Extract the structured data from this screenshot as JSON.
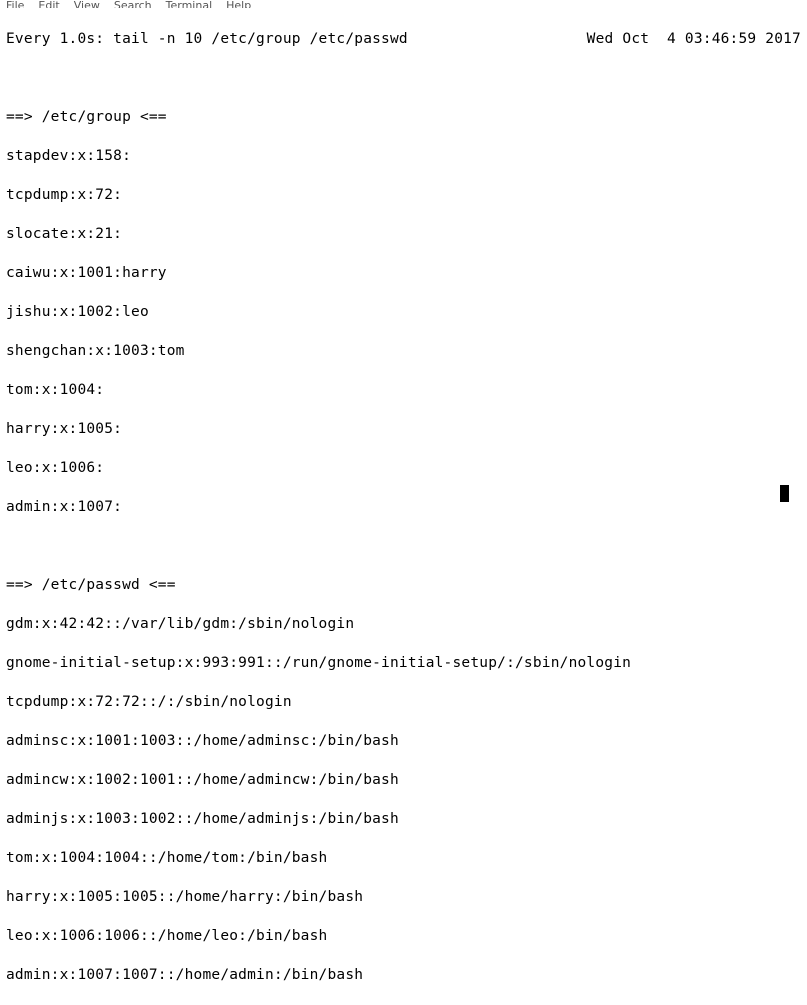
{
  "menu": {
    "file": "File",
    "edit": "Edit",
    "view": "View",
    "search": "Search",
    "terminal": "Terminal",
    "help": "Help"
  },
  "watch": {
    "prefix": "Every 1.0s: tail -n 10 /etc/group /etc/passwd",
    "timestamp": "Wed Oct  4 03:46:59 2017"
  },
  "group_header": "==> /etc/group <==",
  "group_lines": [
    "stapdev:x:158:",
    "tcpdump:x:72:",
    "slocate:x:21:",
    "caiwu:x:1001:harry",
    "jishu:x:1002:leo",
    "shengchan:x:1003:tom",
    "tom:x:1004:",
    "harry:x:1005:",
    "leo:x:1006:",
    "admin:x:1007:"
  ],
  "passwd_header": "==> /etc/passwd <==",
  "passwd_lines": [
    "gdm:x:42:42::/var/lib/gdm:/sbin/nologin",
    "gnome-initial-setup:x:993:991::/run/gnome-initial-setup/:/sbin/nologin",
    "tcpdump:x:72:72::/:/sbin/nologin",
    "adminsc:x:1001:1003::/home/adminsc:/bin/bash",
    "admincw:x:1002:1001::/home/admincw:/bin/bash",
    "adminjs:x:1003:1002::/home/adminjs:/bin/bash",
    "tom:x:1004:1004::/home/tom:/bin/bash",
    "harry:x:1005:1005::/home/harry:/bin/bash",
    "leo:x:1006:1006::/home/leo:/bin/bash",
    "admin:x:1007:1007::/home/admin:/bin/bash"
  ]
}
